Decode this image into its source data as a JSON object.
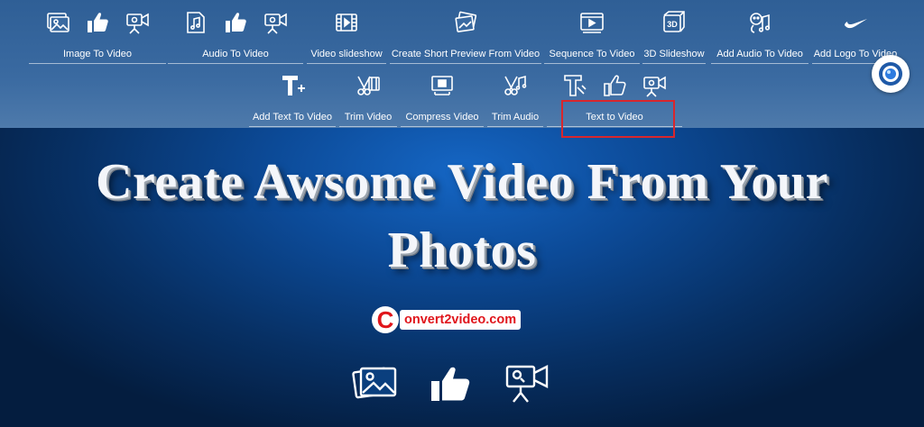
{
  "nav": {
    "row1": [
      {
        "label": "Image To Video",
        "icons": [
          "image-icon",
          "thumbs-up-icon",
          "video-camera-icon"
        ]
      },
      {
        "label": "Audio To Video",
        "icons": [
          "music-file-icon",
          "thumbs-up-icon",
          "video-camera-icon"
        ]
      },
      {
        "label": "Video slideshow",
        "icons": [
          "film-strip-icon"
        ]
      },
      {
        "label": "Create Short Preview From Video",
        "icons": [
          "image-stack-icon"
        ]
      },
      {
        "label": "Sequence To Video",
        "icons": [
          "video-player-icon"
        ]
      },
      {
        "label": "3D Slideshow",
        "icons": [
          "3d-cube-icon"
        ]
      },
      {
        "label": "Add Audio To Video",
        "icons": [
          "music-face-icon"
        ]
      },
      {
        "label": "Add Logo To Video",
        "icons": [
          "swoosh-logo-icon"
        ]
      }
    ],
    "row2": [
      {
        "label": "Add Text To Video",
        "icons": [
          "text-plus-icon"
        ]
      },
      {
        "label": "Trim Video",
        "icons": [
          "scissors-film-icon"
        ]
      },
      {
        "label": "Compress Video",
        "icons": [
          "compress-icon"
        ]
      },
      {
        "label": "Trim Audio",
        "icons": [
          "scissors-audio-icon"
        ]
      },
      {
        "label": "Text to Video",
        "icons": [
          "text-icon",
          "thumbs-up-icon",
          "video-camera-icon"
        ]
      }
    ]
  },
  "highlighted_item": "Text to Video",
  "headline": {
    "line1": "Create Awsome Video From Your",
    "line2": "Photos"
  },
  "brand": {
    "initial": "C",
    "name": "onvert2video.com"
  },
  "bottom_icons": [
    "image-icon",
    "thumbs-up-icon",
    "video-camera-icon"
  ],
  "colors": {
    "accent_red": "#d9262c",
    "nav_bg": "#3a6aa1",
    "text": "#ffffff"
  }
}
